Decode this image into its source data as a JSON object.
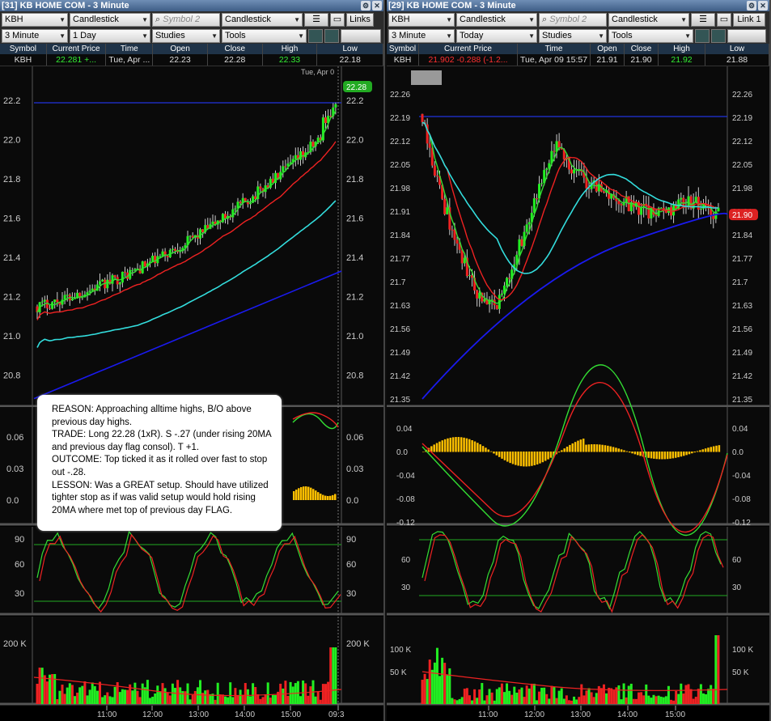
{
  "left": {
    "title": "[31] KB HOME COM - 3 Minute",
    "symbol": "KBH",
    "chart_type": "Candlestick",
    "symbol2_placeholder": "Symbol 2",
    "chart_type2": "Candlestick",
    "links_label": "Links",
    "interval": "3 Minute",
    "range": "1 Day",
    "studies_label": "Studies",
    "tools_label": "Tools",
    "quote_headers": [
      "Symbol",
      "Current Price",
      "Time",
      "Open",
      "Close",
      "High",
      "Low"
    ],
    "quote": {
      "symbol": "KBH",
      "price": "22.281",
      "change": "+...",
      "time": "Tue, Apr ...",
      "open": "22.23",
      "close": "22.28",
      "high": "22.33",
      "low": "22.18"
    },
    "date_label": "Tue, Apr 0",
    "price_marker": "22.28",
    "price_axis": [
      "22.2",
      "22.0",
      "21.8",
      "21.6",
      "21.4",
      "21.2",
      "21.0",
      "20.8"
    ],
    "osc_axis": [
      "0.06",
      "0.03",
      "0.0"
    ],
    "stoch_axis": [
      "90",
      "60",
      "30"
    ],
    "vol_axis": [
      "200 K"
    ],
    "time_axis": [
      "11:00",
      "12:00",
      "13:00",
      "14:00",
      "15:00",
      "09:3"
    ],
    "note": {
      "reason": "REASON: Approaching alltime highs, B/O above previous day highs.",
      "trade": "TRADE: Long 22.28 (1xR). S -.27 (under rising 20MA and previous day flag consol). T +1.",
      "outcome": "OUTCOME: Top ticked it as it rolled over fast to stop out -.28.",
      "lesson": "LESSON: Was a GREAT setup.  Should have utilized tighter stop as if was valid setup would hold rising 20MA where met top of previous day FLAG."
    }
  },
  "right": {
    "title": "[29] KB HOME COM - 3 Minute",
    "symbol": "KBH",
    "chart_type": "Candlestick",
    "symbol2_placeholder": "Symbol 2",
    "chart_type2": "Candlestick",
    "links_label": "Link 1",
    "interval": "3 Minute",
    "range": "Today",
    "studies_label": "Studies",
    "tools_label": "Tools",
    "quote_headers": [
      "Symbol",
      "Current Price",
      "Time",
      "Open",
      "Close",
      "High",
      "Low"
    ],
    "quote": {
      "symbol": "KBH",
      "price": "21.902",
      "change": "-0.288 (-1.2...",
      "time": "Tue, Apr 09  15:57",
      "open": "21.91",
      "close": "21.90",
      "high": "21.92",
      "low": "21.88"
    },
    "price_marker": "21.90",
    "price_axis": [
      "22.26",
      "22.19",
      "22.12",
      "22.05",
      "21.98",
      "21.91",
      "21.84",
      "21.77",
      "21.7",
      "21.63",
      "21.56",
      "21.49",
      "21.42",
      "21.35"
    ],
    "osc_axis": [
      "0.04",
      "0.0",
      "-0.04",
      "-0.08",
      "-0.12"
    ],
    "stoch_axis": [
      "60",
      "30"
    ],
    "vol_axis": [
      "100 K",
      "50 K"
    ],
    "time_axis": [
      "11:00",
      "12:00",
      "13:00",
      "14:00",
      "15:00"
    ]
  },
  "colors": {
    "up": "#22ee22",
    "down": "#ee2222",
    "ma_fast": "#33dd33",
    "ma_mid": "#ee2222",
    "ma_slow": "#33dddd",
    "ma_long": "#1a1aee",
    "hist": "#ffc000"
  }
}
